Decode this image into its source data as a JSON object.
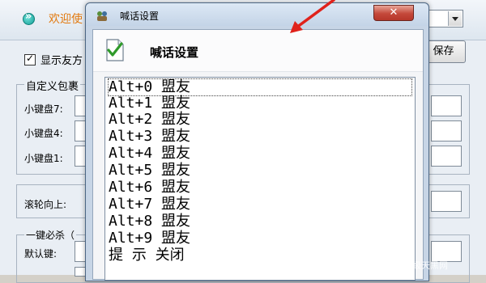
{
  "background": {
    "welcome_text": "欢迎使",
    "show_friend_label": "显示友方",
    "save_label": "保存",
    "group_title": "自定义包裹",
    "rows": [
      {
        "label": "小键盘7:"
      },
      {
        "label": "小键盘4:"
      },
      {
        "label": "小键盘1:"
      },
      {
        "label": "滚轮向上:"
      },
      {
        "label": "一键必杀（"
      },
      {
        "label": "默认键:"
      }
    ]
  },
  "dialog": {
    "title": "喊话设置",
    "header_title": "喊话设置",
    "close_symbol": "✕",
    "list_items": [
      "Alt+0 盟友",
      "Alt+1 盟友",
      "Alt+2 盟友",
      "Alt+3 盟友",
      "Alt+4 盟友",
      "Alt+5 盟友",
      "Alt+6 盟友",
      "Alt+7 盟友",
      "Alt+8 盟友",
      "Alt+9 盟友",
      "提 示 关闭"
    ]
  },
  "watermark": "超级天黑网",
  "colors": {
    "annotation_arrow": "#e0221b",
    "welcome_text": "#e27a10",
    "close_button": "#c4483a"
  },
  "icons": [
    "teal-arrow-icon",
    "app-icon",
    "checklist-icon",
    "dropdown-arrow-icon",
    "close-icon"
  ]
}
